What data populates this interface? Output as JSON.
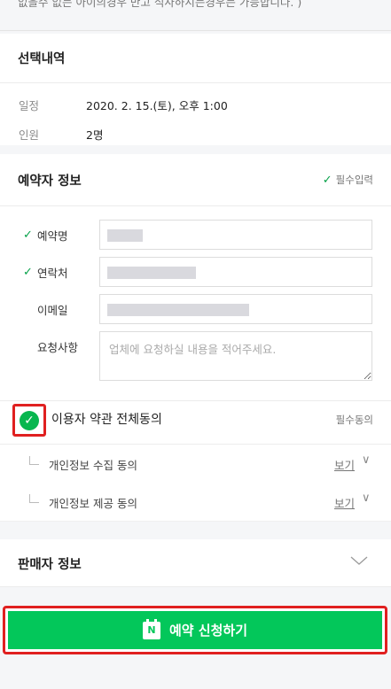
{
  "top_note": "없을수 없는 아이의경우 반고 식사하시는경우는 가능합니다. )",
  "selection": {
    "title": "선택내역",
    "rows": [
      {
        "label": "일정",
        "value": "2020. 2. 15.(토), 오후 1:00"
      },
      {
        "label": "인원",
        "value": "2명"
      }
    ]
  },
  "booker": {
    "title": "예약자 정보",
    "required_note": "필수입력",
    "fields": {
      "name_label": "예약명",
      "contact_label": "연락처",
      "email_label": "이메일",
      "request_label": "요청사항",
      "request_placeholder": "업체에 요청하실 내용을 적어주세요."
    }
  },
  "agreement": {
    "all_label": "이용자 약관 전체동의",
    "required_note": "필수동의",
    "items": [
      {
        "label": "개인정보 수집 동의",
        "view": "보기"
      },
      {
        "label": "개인정보 제공 동의",
        "view": "보기"
      }
    ]
  },
  "seller": {
    "title": "판매자 정보"
  },
  "submit": {
    "label": "예약 신청하기",
    "icon_letter": "N"
  },
  "colors": {
    "accent_green": "#03c75a",
    "highlight_red": "#e02020"
  }
}
